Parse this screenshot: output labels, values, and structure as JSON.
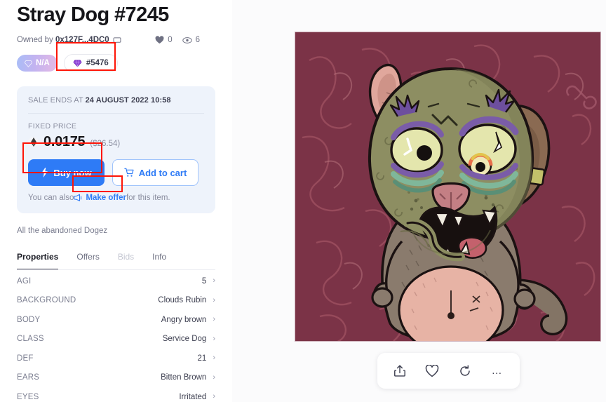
{
  "page": {
    "title": "Stray Dog #7245",
    "owned_by_prefix": "Owned by ",
    "owner_address": "0x127F...4DC0",
    "likes_count": "0",
    "views_count": "6"
  },
  "badges": {
    "rarity_label": "N/A",
    "rank_label": "#5476"
  },
  "sale": {
    "sale_ends_prefix": "SALE ENDS AT ",
    "sale_ends_date": "24 AUGUST 2022 10:58",
    "price_type_label": "FIXED PRICE",
    "price_value": "0.0175",
    "price_usd": "($26.54)",
    "buy_now_label": "Buy now",
    "add_to_cart_label": "Add to cart",
    "offer_prefix": "You can also ",
    "offer_link_label": "Make offer",
    "offer_suffix": " for this item."
  },
  "description": "All the abandoned Dogez",
  "tabs": [
    {
      "label": "Properties",
      "state": "active"
    },
    {
      "label": "Offers",
      "state": "default"
    },
    {
      "label": "Bids",
      "state": "disabled"
    },
    {
      "label": "Info",
      "state": "default"
    }
  ],
  "properties": [
    {
      "key": "AGI",
      "value": "5"
    },
    {
      "key": "BACKGROUND",
      "value": "Clouds Rubin"
    },
    {
      "key": "BODY",
      "value": "Angry brown"
    },
    {
      "key": "CLASS",
      "value": "Service Dog"
    },
    {
      "key": "DEF",
      "value": "21"
    },
    {
      "key": "EARS",
      "value": "Bitten Brown"
    },
    {
      "key": "EYES",
      "value": "Irritated"
    }
  ],
  "action_bar": {
    "share": "share-icon",
    "favorite": "heart-icon",
    "refresh": "refresh-icon",
    "more": "…"
  },
  "colors": {
    "accent_blue": "#2e7bf6",
    "card_bg": "#eef3fb",
    "annotation_red": "#fe1507",
    "nft_background": "#7b3347",
    "nft_body": "#8d8e62"
  }
}
